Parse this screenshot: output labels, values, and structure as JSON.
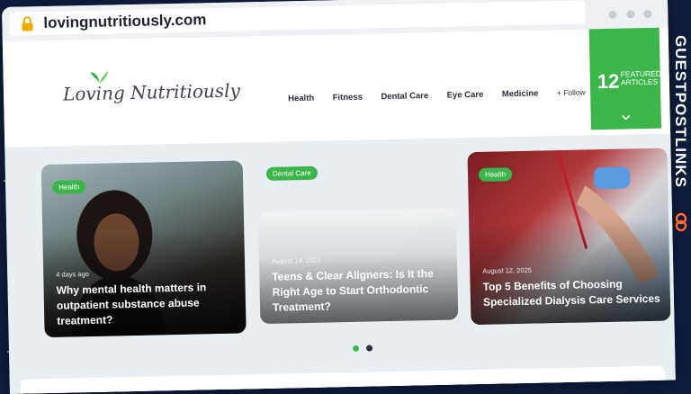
{
  "browser": {
    "url": "lovingnutritiously.com"
  },
  "site": {
    "logo_text": "Loving Nutritiously",
    "nav": [
      {
        "label": "Health"
      },
      {
        "label": "Fitness"
      },
      {
        "label": "Dental Care"
      },
      {
        "label": "Eye Care"
      },
      {
        "label": "Medicine"
      }
    ],
    "follow_label": "+ Follow",
    "featured": {
      "count": "12",
      "label": "FEATURED ARTICLES"
    },
    "accent_color": "#3cb64a"
  },
  "cards": [
    {
      "badge": "Health",
      "date": "4 days ago",
      "title": "Why mental health matters in outpatient substance abuse treatment?"
    },
    {
      "badge": "Dental Care",
      "date": "August 14, 2025",
      "title": "Teens & Clear Aligners: Is It the Right Age to Start Orthodontic Treatment?"
    },
    {
      "badge": "Health",
      "date": "August 12, 2025",
      "title": "Top 5 Benefits of Choosing Specialized Dialysis Care Services"
    }
  ],
  "pager": {
    "active_index": 0,
    "count": 2
  },
  "brand": {
    "name": "GUESTPOSTLINKS"
  }
}
